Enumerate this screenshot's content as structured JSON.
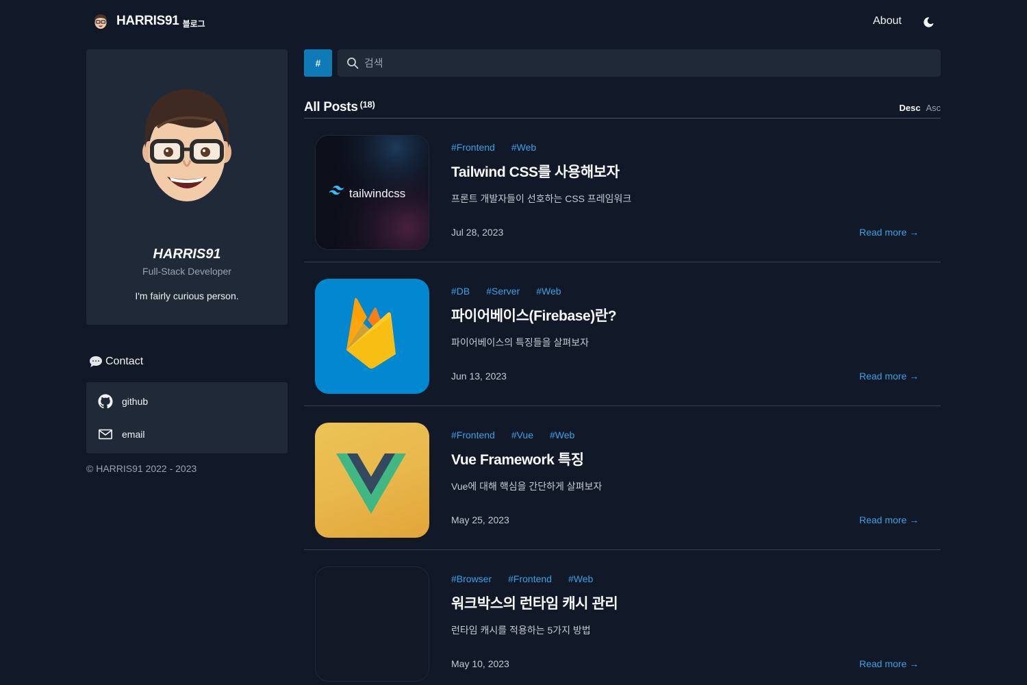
{
  "header": {
    "brand_name": "HARRIS91",
    "brand_sub": "블로그",
    "nav_about": "About",
    "theme_icon": "moon-icon"
  },
  "profile": {
    "name": "HARRIS91",
    "role": "Full-Stack Developer",
    "bio": "I'm fairly curious person."
  },
  "contact": {
    "title": "Contact",
    "items": [
      {
        "label": "github",
        "icon": "github-icon"
      },
      {
        "label": "email",
        "icon": "mail-icon"
      }
    ]
  },
  "footer": {
    "copyright": "© HARRIS91 2022 - 2023"
  },
  "search": {
    "tag_button_label": "#",
    "placeholder": "검색"
  },
  "posts_header": {
    "title": "All Posts",
    "count": "(18)",
    "sort_desc": "Desc",
    "sort_asc": "Asc"
  },
  "posts": [
    {
      "tags": [
        "#Frontend",
        "#Web"
      ],
      "title": "Tailwind CSS를 사용해보자",
      "description": "프론트 개발자들이 선호하는 CSS 프레임워크",
      "date": "Jul 28, 2023",
      "read_more": "Read more →",
      "thumb_text": "tailwindcss"
    },
    {
      "tags": [
        "#DB",
        "#Server",
        "#Web"
      ],
      "title": "파이어베이스(Firebase)란?",
      "description": "파이어베이스의 특징들을 살펴보자",
      "date": "Jun 13, 2023",
      "read_more": "Read more →"
    },
    {
      "tags": [
        "#Frontend",
        "#Vue",
        "#Web"
      ],
      "title": "Vue Framework 특징",
      "description": "Vue에 대해 핵심을 간단하게 살펴보자",
      "date": "May 25, 2023",
      "read_more": "Read more →"
    },
    {
      "tags": [
        "#Browser",
        "#Frontend",
        "#Web"
      ],
      "title": "워크박스의 런타임 캐시 관리",
      "description": "런타임 캐시를 적용하는 5가지 방법",
      "date": "May 10, 2023",
      "read_more": "Read more →"
    }
  ],
  "colors": {
    "background": "#111827",
    "card": "#1f2937",
    "accent": "#38a3e6",
    "tag_button": "#0e7ab6"
  }
}
